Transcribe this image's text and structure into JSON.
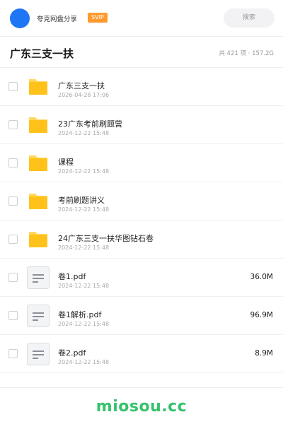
{
  "header": {
    "username": "夸克网盘分享",
    "badge": "SVIP",
    "search_placeholder": "搜索",
    "avatar_color": "#1f76f5"
  },
  "folder": {
    "title": "广东三支一扶",
    "summary": "共 421 项 · 157.2G"
  },
  "items": [
    {
      "type": "folder",
      "icon": "folder-icon",
      "name": "广东三支一扶",
      "date": "2026-04-28 17:06",
      "size": ""
    },
    {
      "type": "folder",
      "icon": "folder-icon",
      "name": "23广东考前刷题营",
      "date": "2024-12-22 15:48",
      "size": ""
    },
    {
      "type": "folder",
      "icon": "folder-icon",
      "name": "课程",
      "date": "2024-12-22 15:48",
      "size": ""
    },
    {
      "type": "folder",
      "icon": "folder-icon",
      "name": "考前刷题讲义",
      "date": "2024-12-22 15:48",
      "size": ""
    },
    {
      "type": "folder",
      "icon": "folder-icon",
      "name": "24广东三支一扶华图钻石卷",
      "date": "2024-12-22 15:48",
      "size": ""
    },
    {
      "type": "file",
      "icon": "document-icon",
      "name": "卷1.pdf",
      "date": "2024-12-22 15:48",
      "size": "36.0M"
    },
    {
      "type": "file",
      "icon": "document-icon",
      "name": "卷1解析.pdf",
      "date": "2024-12-22 15:48",
      "size": "96.9M"
    },
    {
      "type": "file",
      "icon": "document-icon",
      "name": "卷2.pdf",
      "date": "2024-12-22 15:48",
      "size": "8.9M"
    }
  ],
  "footer": {
    "watermark": "miosou.cc"
  },
  "colors": {
    "folder": "#ffc21a",
    "folder_tab": "#ffd75e",
    "watermark": "#34c36b",
    "badge": "#ff9a2e"
  }
}
